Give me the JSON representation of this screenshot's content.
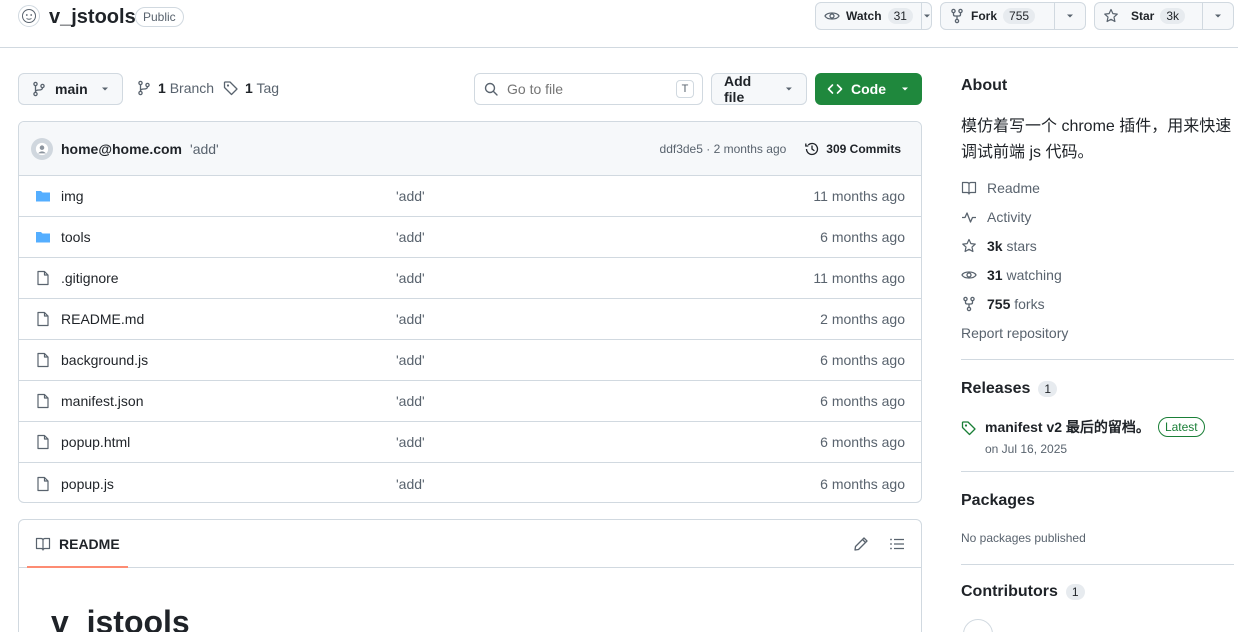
{
  "repo": {
    "name": "v_jstools",
    "visibility": "Public"
  },
  "header_actions": {
    "watch_label": "Watch",
    "watch_count": "31",
    "fork_label": "Fork",
    "fork_count": "755",
    "star_label": "Star",
    "star_count": "3k"
  },
  "toolbar": {
    "branch": "main",
    "branches_count": "1",
    "branches_label": "Branch",
    "tags_count": "1",
    "tags_label": "Tag",
    "search_placeholder": "Go to file",
    "search_shortcut": "T",
    "add_file_label": "Add file",
    "code_label": "Code"
  },
  "latest_commit": {
    "author": "home@home.com",
    "message": "'add'",
    "meta": "ddf3de5 · 2 months ago",
    "commits_label": "309 Commits"
  },
  "files": [
    {
      "name": "img",
      "type": "folder",
      "message": "'add'",
      "time": "11 months ago"
    },
    {
      "name": "tools",
      "type": "folder",
      "message": "'add'",
      "time": "6 months ago"
    },
    {
      "name": ".gitignore",
      "type": "file",
      "message": "'add'",
      "time": "11 months ago"
    },
    {
      "name": "README.md",
      "type": "file",
      "message": "'add'",
      "time": "2 months ago"
    },
    {
      "name": "background.js",
      "type": "file",
      "message": "'add'",
      "time": "6 months ago"
    },
    {
      "name": "manifest.json",
      "type": "file",
      "message": "'add'",
      "time": "6 months ago"
    },
    {
      "name": "popup.html",
      "type": "file",
      "message": "'add'",
      "time": "6 months ago"
    },
    {
      "name": "popup.js",
      "type": "file",
      "message": "'add'",
      "time": "6 months ago"
    }
  ],
  "readme": {
    "tab_label": "README",
    "title": "v_jstools"
  },
  "sidebar": {
    "about_heading": "About",
    "description": "模仿着写一个 chrome 插件，用来快速调试前端 js 代码。",
    "readme_link": "Readme",
    "activity_link": "Activity",
    "stars_count": "3k",
    "stars_label": "stars",
    "watching_count": "31",
    "watching_label": "watching",
    "forks_count": "755",
    "forks_label": "forks",
    "report_link": "Report repository",
    "releases_heading": "Releases",
    "releases_count": "1",
    "release_title": "manifest v2 最后的留档。",
    "release_badge": "Latest",
    "release_date": "on Jul 16, 2025",
    "packages_heading": "Packages",
    "packages_text": "No packages published",
    "contributors_heading": "Contributors",
    "contributors_count": "1"
  },
  "colors": {
    "accent_green": "#1f883d",
    "folder_blue": "#54aeff",
    "border": "#d1d9e0",
    "muted_text": "#59636e"
  }
}
